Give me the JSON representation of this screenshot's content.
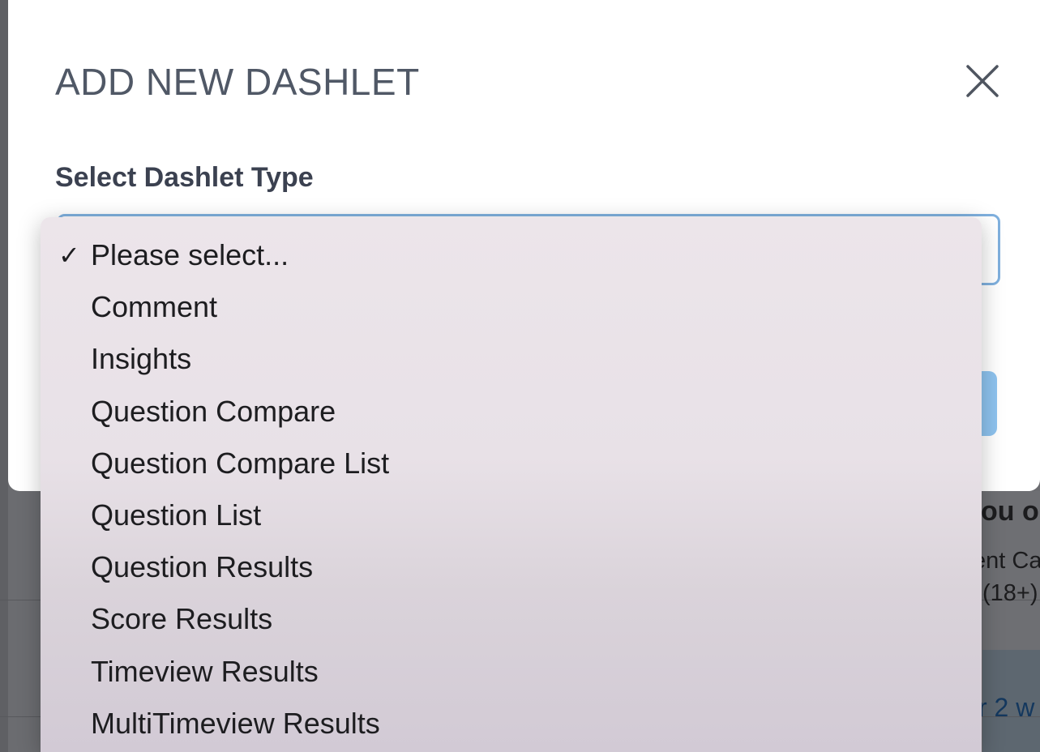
{
  "background": {
    "heading_fragment": "ou o",
    "text_fragment_1": "ent Ca",
    "text_fragment_2": "(18+)",
    "link_fragment": "r 2 w"
  },
  "modal": {
    "title": "ADD NEW DASHLET",
    "close_icon": "close-icon",
    "field_label": "Select Dashlet Type"
  },
  "dropdown": {
    "selected_mark": "✓",
    "items": [
      {
        "label": "Please select...",
        "selected": true
      },
      {
        "label": "Comment",
        "selected": false
      },
      {
        "label": "Insights",
        "selected": false
      },
      {
        "label": "Question Compare",
        "selected": false
      },
      {
        "label": "Question Compare List",
        "selected": false
      },
      {
        "label": "Question List",
        "selected": false
      },
      {
        "label": "Question Results",
        "selected": false
      },
      {
        "label": "Score Results",
        "selected": false
      },
      {
        "label": "Timeview Results",
        "selected": false
      },
      {
        "label": "MultiTimeview Results",
        "selected": false
      }
    ]
  },
  "colors": {
    "title": "#505866",
    "label": "#3b4150",
    "select_border": "#7fb0de",
    "primary_button": "#8ec3ef"
  }
}
